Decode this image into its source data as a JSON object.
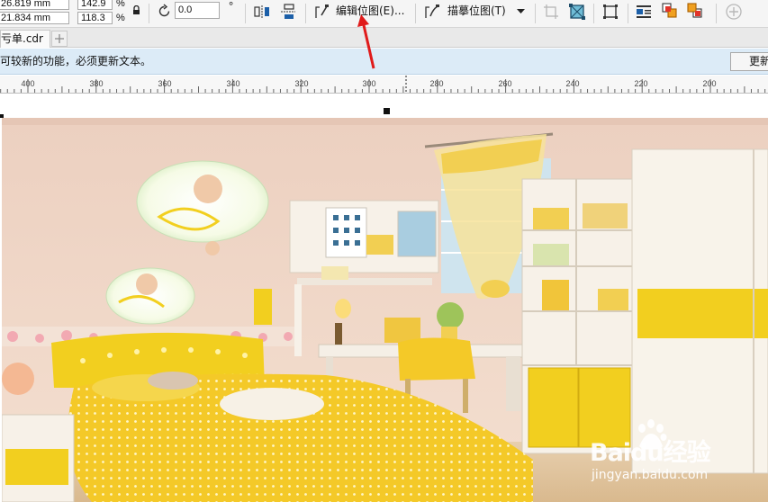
{
  "property_bar": {
    "width_value": "26.819 mm",
    "height_value": "21.834 mm",
    "scale_x_value": "142.9",
    "scale_y_value": "118.3",
    "percent_symbol": "%",
    "rotation_value": "0.0",
    "degree_symbol": "°",
    "edit_bitmap_label": "编辑位图(E)...",
    "trace_bitmap_label": "描摹位图(T)",
    "icons": [
      "lock-icon",
      "rotate-icon",
      "mirror-horizontal-icon",
      "mirror-vertical-icon",
      "edit-bitmap-icon",
      "trace-bitmap-icon",
      "dropdown-arrow-icon",
      "crop-bitmap-icon",
      "resample-icon",
      "bitmap-frame-icon",
      "wrap-text-icon",
      "to-front-icon",
      "to-back-icon",
      "add-icon"
    ]
  },
  "document_tab": {
    "title": "未命名清单.cdr",
    "visible_title": "亏单.cdr"
  },
  "notice_bar": {
    "message": "可较新的功能，必须更新文本。",
    "button_label": "更新"
  },
  "ruler": {
    "labels": [
      "400",
      "380",
      "360",
      "340",
      "320",
      "300",
      "280",
      "260",
      "240",
      "220",
      "200"
    ]
  },
  "watermark": {
    "brand": "Baidu经验",
    "url": "jingyan.baidu.com"
  },
  "colors": {
    "toolbar_bg": "#f5f5f5",
    "notice_bg": "#dcebf7",
    "annotation_arrow": "#e01b1b",
    "room_wall": "#f1d8c8",
    "furniture_yellow": "#f2d01a"
  }
}
